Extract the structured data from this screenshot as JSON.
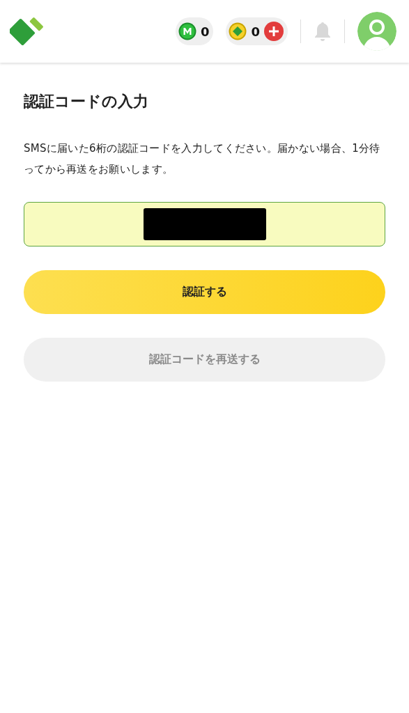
{
  "header": {
    "points": [
      {
        "kind": "mile",
        "count": "0"
      },
      {
        "kind": "coin",
        "count": "0"
      }
    ]
  },
  "page": {
    "title": "認証コードの入力",
    "description": "SMSに届いた6桁の認証コードを入力してください。届かない場合、1分待ってから再送をお願いします。"
  },
  "code_field": {
    "redacted": true
  },
  "buttons": [
    {
      "label": "認証する",
      "disabled": false
    },
    {
      "label": "認証コードを再送する",
      "disabled": true
    }
  ]
}
